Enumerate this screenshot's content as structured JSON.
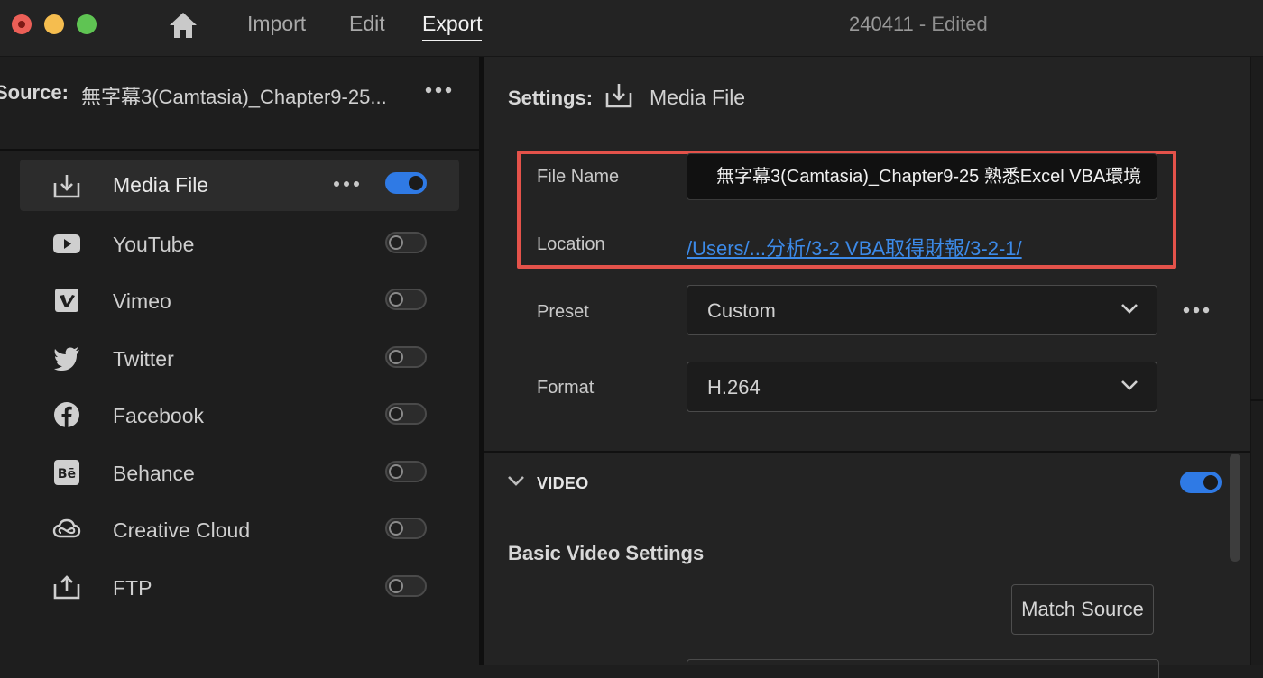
{
  "window": {
    "nav": {
      "import": "Import",
      "edit": "Edit",
      "export": "Export"
    },
    "doc_name": "240411",
    "doc_status": " - Edited"
  },
  "source": {
    "label": "Source:",
    "value": "無字幕3(Camtasia)_Chapter9-25..."
  },
  "destinations": [
    {
      "label": "Media File",
      "icon": "download-icon",
      "enabled": true
    },
    {
      "label": "YouTube",
      "icon": "youtube-icon",
      "enabled": false
    },
    {
      "label": "Vimeo",
      "icon": "vimeo-icon",
      "enabled": false
    },
    {
      "label": "Twitter",
      "icon": "twitter-icon",
      "enabled": false
    },
    {
      "label": "Facebook",
      "icon": "facebook-icon",
      "enabled": false
    },
    {
      "label": "Behance",
      "icon": "behance-icon",
      "enabled": false
    },
    {
      "label": "Creative Cloud",
      "icon": "creative-cloud-icon",
      "enabled": false
    },
    {
      "label": "FTP",
      "icon": "upload-icon",
      "enabled": false
    }
  ],
  "settings": {
    "label": "Settings:",
    "value": "Media File",
    "file_name_label": "File Name",
    "file_name_value": "無字幕3(Camtasia)_Chapter9-25 熟悉Excel VBA環境",
    "location_label": "Location",
    "location_value": "/Users/...分析/3-2 VBA取得財報/3-2-1/",
    "preset_label": "Preset",
    "preset_value": "Custom",
    "format_label": "Format",
    "format_value": "H.264"
  },
  "video": {
    "section_label": "VIDEO",
    "enabled": true,
    "basic_settings_label": "Basic Video Settings",
    "match_source_label": "Match Source"
  },
  "colors": {
    "accent": "#2f7ae5",
    "highlight": "#e4524a",
    "link": "#3c8ae8"
  }
}
